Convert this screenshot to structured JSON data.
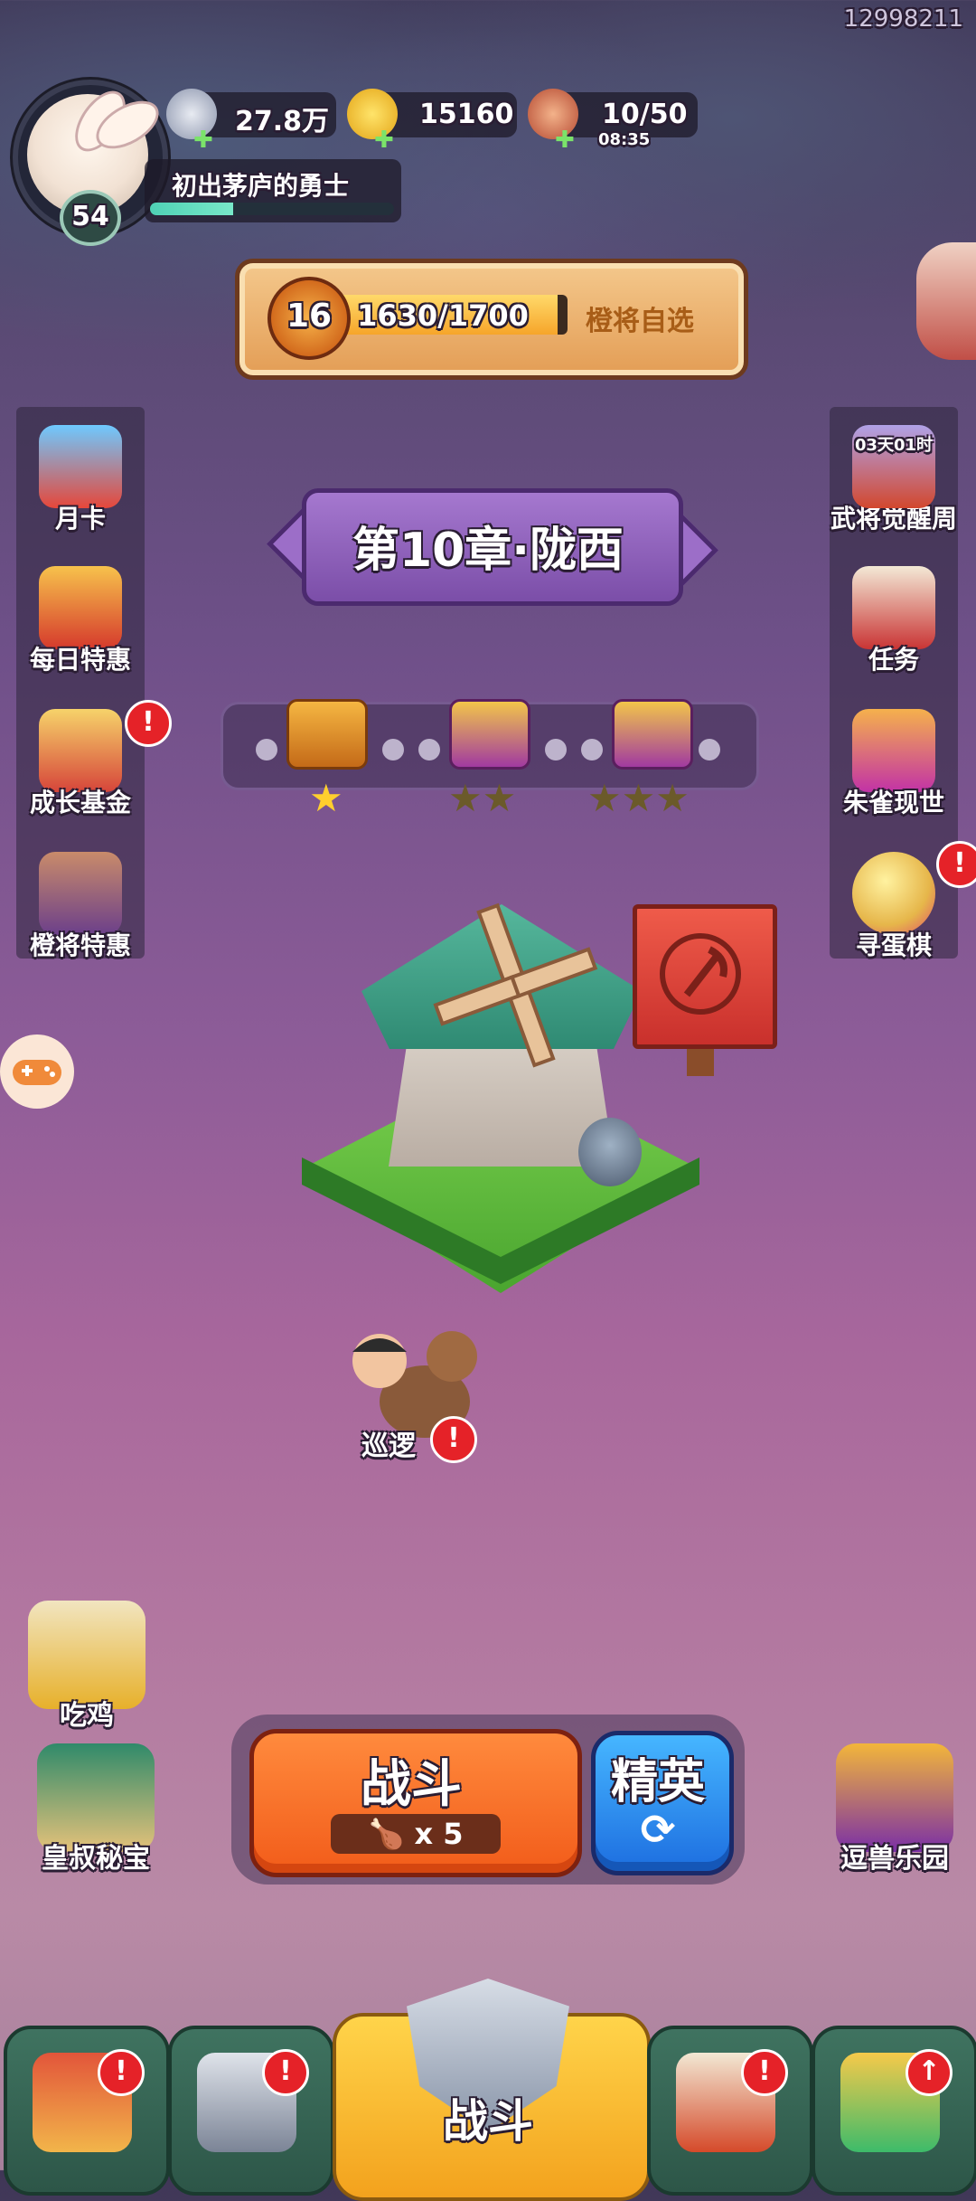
{
  "uid": "12998211",
  "player": {
    "level": "54",
    "title": "初出茅庐的勇士",
    "xp_fraction": 0.34
  },
  "resources": {
    "silver": "27.8万",
    "gold": "15160",
    "stamina": "10/50",
    "stamina_timer": "08:35"
  },
  "progress": {
    "medal_level": "16",
    "value": "1630/1700",
    "fraction": 0.959,
    "label": "橙将自选"
  },
  "left_menu": [
    {
      "label": "月卡",
      "icon": "month-card-icon"
    },
    {
      "label": "每日特惠",
      "icon": "daily-deal-icon"
    },
    {
      "label": "成长基金",
      "icon": "growth-fund-icon",
      "badge": "!"
    },
    {
      "label": "橙将特惠",
      "icon": "orange-general-deal-icon"
    }
  ],
  "right_menu": [
    {
      "label": "武将觉醒周",
      "icon": "general-awakening-icon",
      "timer": "03天01时"
    },
    {
      "label": "任务",
      "icon": "quest-scroll-icon"
    },
    {
      "label": "朱雀现世",
      "icon": "vermilion-bird-icon"
    },
    {
      "label": "寻蛋棋",
      "icon": "egg-chess-icon",
      "badge": "!"
    }
  ],
  "chapter": {
    "title": "第10章·陇西"
  },
  "rewards": [
    {
      "stars": 1,
      "star_text": "★"
    },
    {
      "stars": 2,
      "star_text": "★★"
    },
    {
      "stars": 3,
      "star_text": "★★★"
    }
  ],
  "map": {
    "patrol_label": "巡逻",
    "patrol_badge": "!"
  },
  "left_bottom": [
    {
      "label": "吃鸡",
      "icon": "chicken-game-icon"
    },
    {
      "label": "皇叔秘宝",
      "icon": "uncle-treasure-icon"
    }
  ],
  "right_bottom": {
    "label": "逗兽乐园",
    "icon": "beast-park-icon"
  },
  "battle": {
    "fight_label": "战斗",
    "fight_cost": "x 5",
    "elite_label": "精英",
    "elite_refresh": "⟳"
  },
  "bottom_nav": [
    {
      "name": "shop",
      "icon": "shop-gate-icon",
      "badge": "!"
    },
    {
      "name": "equipment",
      "icon": "helmet-icon",
      "badge": "!"
    },
    {
      "name": "battle",
      "icon": "battle-shield-icon",
      "label": "战斗"
    },
    {
      "name": "heroes",
      "icon": "horn-stars-icon",
      "badge": "!"
    },
    {
      "name": "upgrade",
      "icon": "fist-upgrade-icon",
      "badge": "↑"
    }
  ],
  "colors": {
    "accent_orange": "#f25c1a",
    "accent_blue": "#1d6ee0",
    "badge_red": "#e52228",
    "nav_green": "#2d5648",
    "nav_gold": "#f3a21d"
  }
}
